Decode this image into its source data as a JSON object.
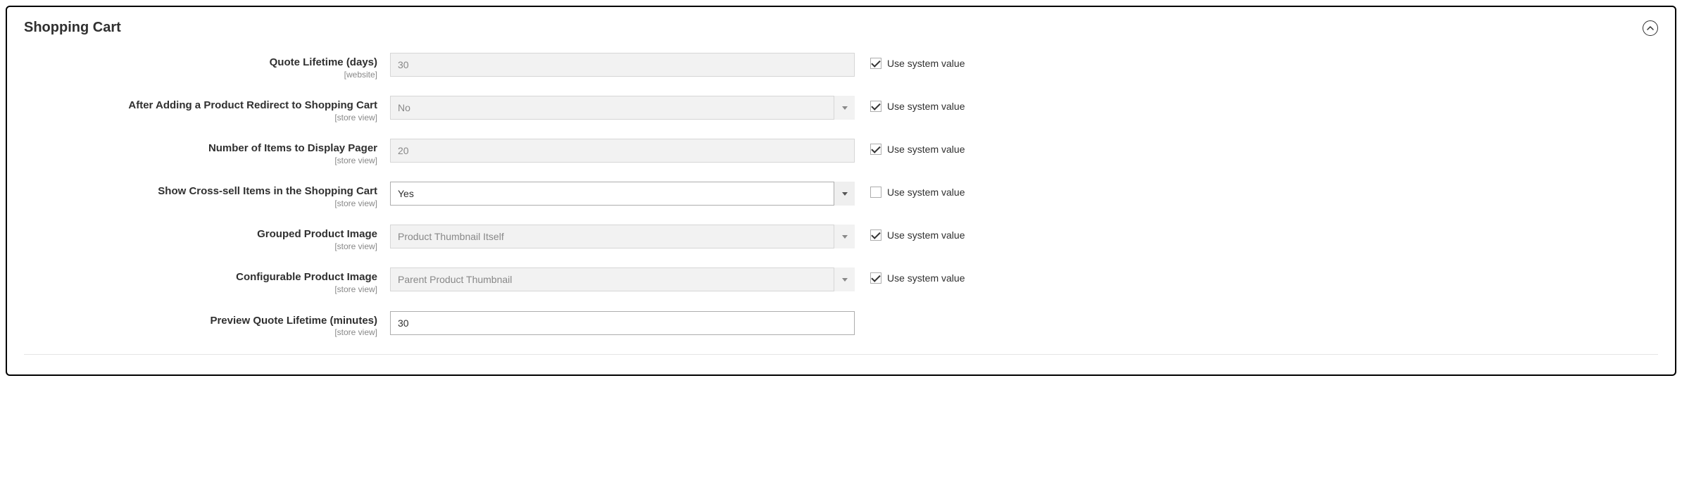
{
  "section": {
    "title": "Shopping Cart",
    "system_value_label": "Use system value"
  },
  "fields": {
    "quote_lifetime": {
      "label": "Quote Lifetime (days)",
      "scope": "[website]",
      "value": "30",
      "use_system": true
    },
    "redirect_to_cart": {
      "label": "After Adding a Product Redirect to Shopping Cart",
      "scope": "[store view]",
      "value": "No",
      "use_system": true
    },
    "pager_items": {
      "label": "Number of Items to Display Pager",
      "scope": "[store view]",
      "value": "20",
      "use_system": true
    },
    "crosssell": {
      "label": "Show Cross-sell Items in the Shopping Cart",
      "scope": "[store view]",
      "value": "Yes",
      "use_system": false
    },
    "grouped_image": {
      "label": "Grouped Product Image",
      "scope": "[store view]",
      "value": "Product Thumbnail Itself",
      "use_system": true
    },
    "configurable_image": {
      "label": "Configurable Product Image",
      "scope": "[store view]",
      "value": "Parent Product Thumbnail",
      "use_system": true
    },
    "preview_quote": {
      "label": "Preview Quote Lifetime (minutes)",
      "scope": "[store view]",
      "value": "30"
    }
  }
}
